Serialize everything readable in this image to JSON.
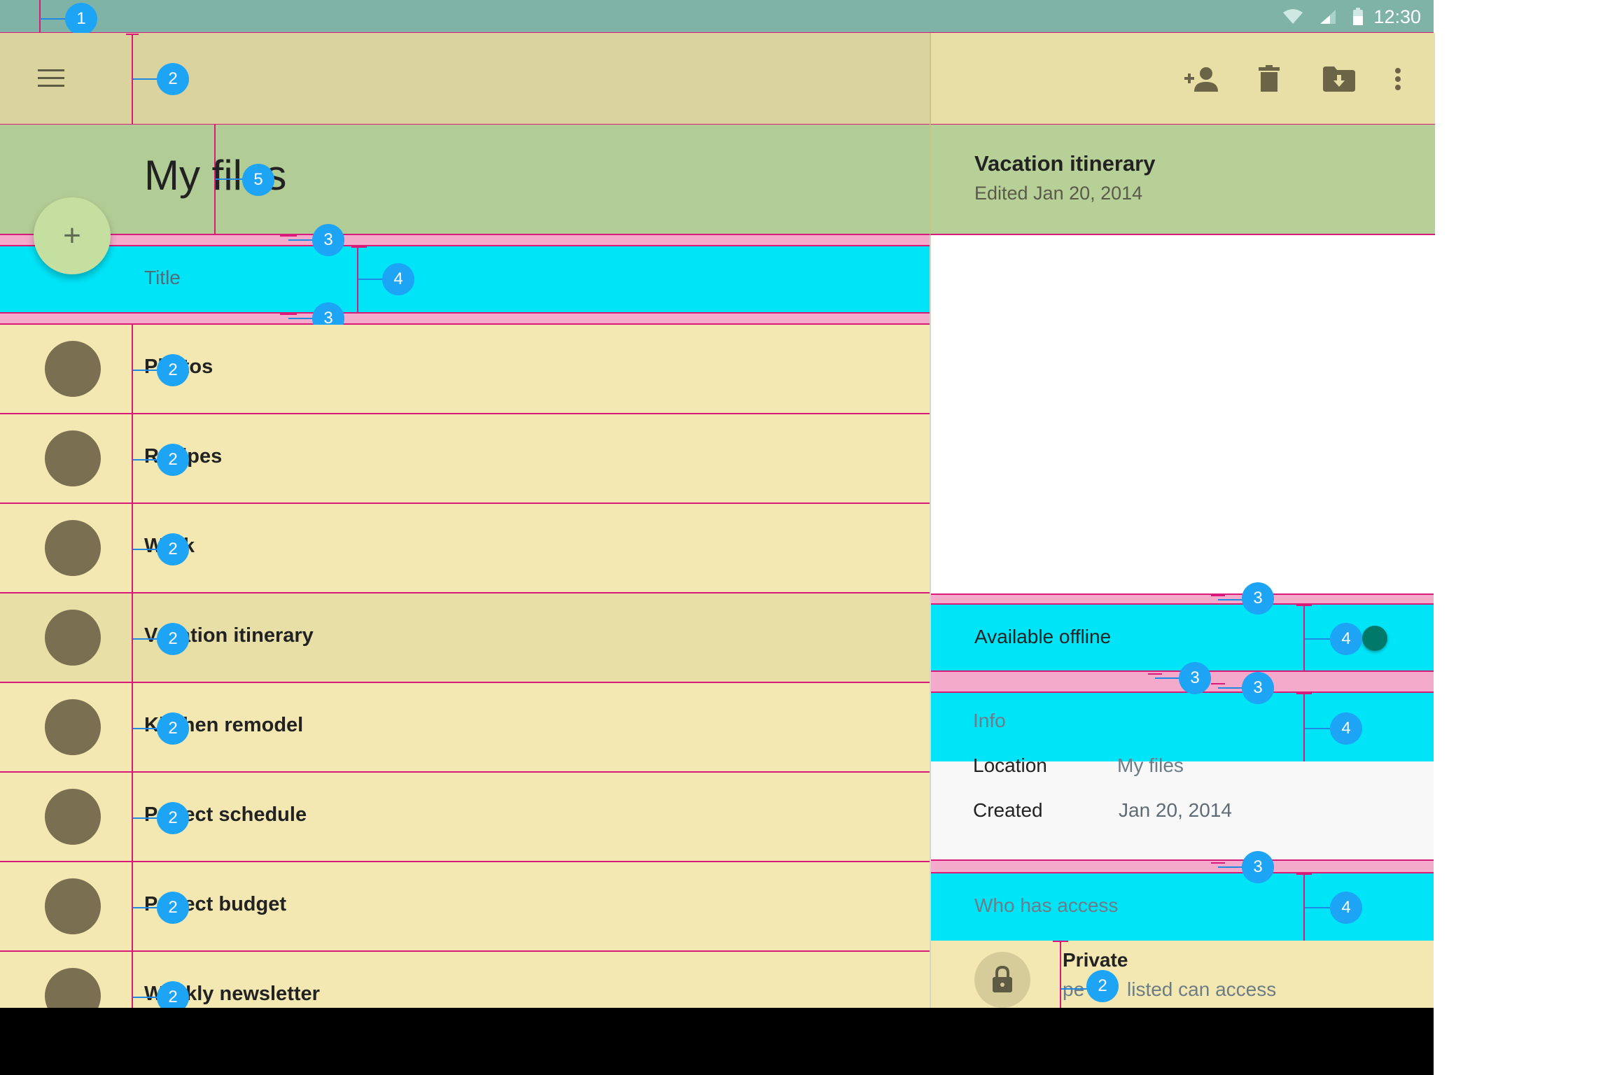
{
  "status_bar": {
    "time": "12:30",
    "icons": [
      "wifi-icon",
      "signal-icon",
      "battery-icon"
    ]
  },
  "toolbar": {
    "menu_icon": "menu-icon",
    "actions": [
      "add-person-icon",
      "delete-icon",
      "move-to-folder-icon",
      "more-vert-icon"
    ]
  },
  "page": {
    "title": "My files"
  },
  "list_header": {
    "label": "Title"
  },
  "files": [
    {
      "name": "Photos",
      "visible": "P",
      "tail": "os"
    },
    {
      "name": "Recipes",
      "visible": "R",
      "tail": "pes"
    },
    {
      "name": "Work",
      "visible": "W",
      "tail": ""
    },
    {
      "name": "Vacation itinerary",
      "visible": "V",
      "tail": "tion itinerary",
      "selected": true
    },
    {
      "name": "Kitchen remodel",
      "visible": "K",
      "tail": "en remodel"
    },
    {
      "name": "Project schedule",
      "visible": "P",
      "tail": "ct schedule"
    },
    {
      "name": "Project budget",
      "visible": "P",
      "tail": "ct budget"
    },
    {
      "name": "Weekly newsletter",
      "visible": "W",
      "tail": "kly newsletter"
    }
  ],
  "detail": {
    "title": "Vacation itinerary",
    "subtitle": "Edited Jan 20, 2014",
    "offline_label": "Available offline",
    "offline_on": true,
    "info_header": "Info",
    "location_label": "Location",
    "location_value": "My files",
    "created_label": "Created",
    "created_value": "Jan 20, 2014",
    "access_header": "Who has access",
    "access_title": "Private",
    "access_sub_head": "pe",
    "access_sub_tail": "listed can access"
  },
  "annotations": {
    "status_bar": "1",
    "content_inset": "2",
    "padding": "3",
    "subheader": "4",
    "title_inset": "5"
  },
  "colors": {
    "keyline": "#d81b7a",
    "marker": "#1ea4f5",
    "subheader_fill": "#00e4f8",
    "padding_fill": "#f4aacb"
  }
}
